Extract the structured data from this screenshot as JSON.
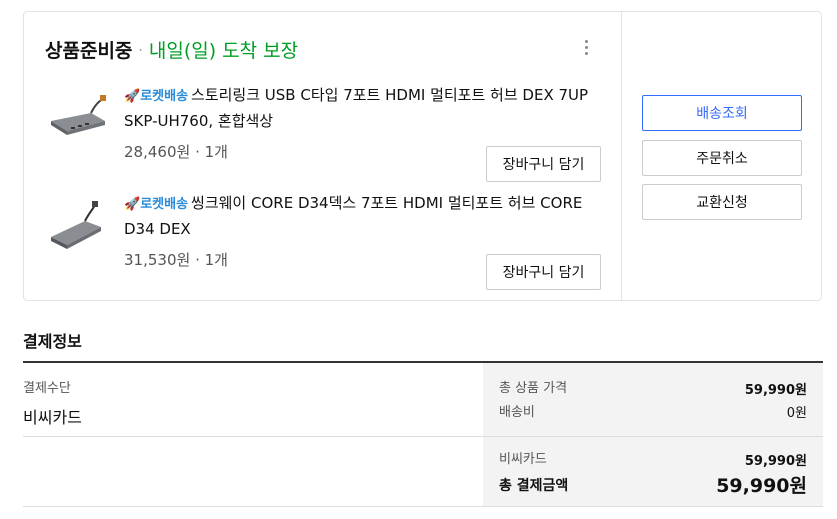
{
  "order": {
    "status": "상품준비중",
    "status_separator": "·",
    "delivery_promise": "내일(일) 도착 보장",
    "items": [
      {
        "badge_icon": "rocket-icon",
        "badge_label": "로켓배송",
        "title": "스토리링크 USB C타입 7포트 HDMI 멀티포트 허브 DEX 7UP SKP-UH760, 혼합색상",
        "price": "28,460원",
        "quantity": "1개",
        "cart_button": "장바구니 담기"
      },
      {
        "badge_icon": "rocket-icon",
        "badge_label": "로켓배송",
        "title": "씽크웨이 CORE D34덱스 7포트 HDMI 멀티포트 허브 CORE D34 DEX",
        "price": "31,530원",
        "quantity": "1개",
        "cart_button": "장바구니 담기"
      }
    ],
    "actions": {
      "track": "배송조회",
      "cancel": "주문취소",
      "exchange": "교환신청"
    }
  },
  "payment": {
    "heading": "결제정보",
    "method_label": "결제수단",
    "method_value": "비씨카드",
    "product_total_label": "총 상품 가격",
    "product_total_value": "59,990원",
    "shipping_label": "배송비",
    "shipping_value": "0원",
    "card_label": "비씨카드",
    "card_value": "59,990원",
    "grand_total_label": "총 결제금액",
    "grand_total_value": "59,990원"
  },
  "colors": {
    "accent_blue": "#346aff",
    "status_green": "#009e24",
    "rocket_blue": "#2a8bd8"
  }
}
